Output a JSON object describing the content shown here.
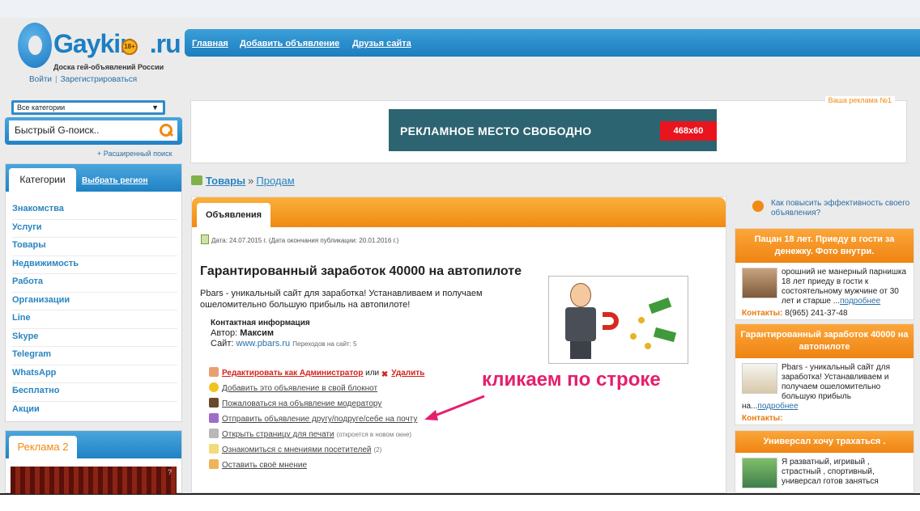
{
  "header": {
    "logo_text": "Gaykin",
    "logo_suffix": ".ru",
    "logo_badge": "18+",
    "logo_subtitle": "Доска гей-объявлений России",
    "login": "Войти",
    "separator": "|",
    "register": "Зарегистрироваться",
    "nav": [
      "Главная",
      "Добавить объявление",
      "Друзья сайта"
    ]
  },
  "sidebar": {
    "category_select": "Все категории",
    "search_placeholder": "Быстрый G-поиск..",
    "advanced_search": "+ Расширенный поиск",
    "categories_tab": "Категории",
    "region_link": "Выбрать регион",
    "categories": [
      "Знакомства",
      "Услуги",
      "Товары",
      "Недвижимость",
      "Работа",
      "Организации",
      "Line",
      "Skype",
      "Telegram",
      "WhatsApp",
      "Бесплатно",
      "Акции"
    ],
    "ad2_title": "Реклама 2"
  },
  "banner": {
    "label": "Ваша реклама №1",
    "text": "РЕКЛАМНОЕ  МЕСТО СВОБОДНО",
    "size": "468x60"
  },
  "breadcrumb": {
    "section": "Товары",
    "separator": "»",
    "current": "Продам"
  },
  "listing": {
    "tab": "Объявления",
    "date": "Дата: 24.07.2015 г. (Дата окончания публикации: 20.01.2016 г.)",
    "title": "Гарантированный заработок 40000 на автопилоте",
    "description": "Pbars - уникальный сайт для заработка! Устанавливаем и получаем ошеломительно большую прибыль на автопилоте!",
    "contact_heading": "Контактная информация",
    "author_label": "Автор:",
    "author": "Максим",
    "site_label": "Сайт:",
    "site": "www.pbars.ru",
    "transitions": "Переходов на сайт: 5",
    "actions": {
      "edit": "Редактировать как Администратор",
      "or": "или",
      "delete": "Удалить",
      "notebook": "Добавить это объявление в свой блокнот",
      "complain": "Пожаловаться на объявление модератору",
      "send": "Отправить объявление другу/подруге/себе на почту",
      "print": "Открыть страницу для печати",
      "print_note": "(откроется в новом окне)",
      "opinions": "Ознакомиться с мнениями посетителей",
      "opinions_count": "(2)",
      "leave_opinion": "Оставить своё мнение"
    }
  },
  "annotation": "кликаем по строке",
  "right": {
    "tip": "Как повысить эффективность своего объявления?",
    "cards": [
      {
        "title": "Пацан 18 лет. Приеду в гости за денежку. Фото внутри.",
        "text": "орошний не манерный парнишка 18 лет приеду в гости к состоятельному мужчине от 30 лет и старше ...",
        "more": "подробнее",
        "contacts_label": "Контакты:",
        "contacts": "8(965) 241-37-48"
      },
      {
        "title": "Гарантированный заработок 40000 на автопилоте",
        "text": "Pbars - уникальный сайт для заработка! Устанавливаем и получаем ошеломительно большую прибыль на...",
        "more": "подробнее",
        "contacts_label": "Контакты:",
        "contacts": ""
      },
      {
        "title": "Универсал хочу трахаться .",
        "text": "Я разватный, игривый , страстный , спортивный, универсал готов заняться",
        "more": "",
        "contacts_label": "",
        "contacts": ""
      }
    ]
  },
  "colors": {
    "accent_blue": "#2082c5",
    "accent_orange": "#ef8a12",
    "annotation_pink": "#e61e6e",
    "banner_teal": "#2d6471",
    "banner_red": "#e8141e"
  }
}
